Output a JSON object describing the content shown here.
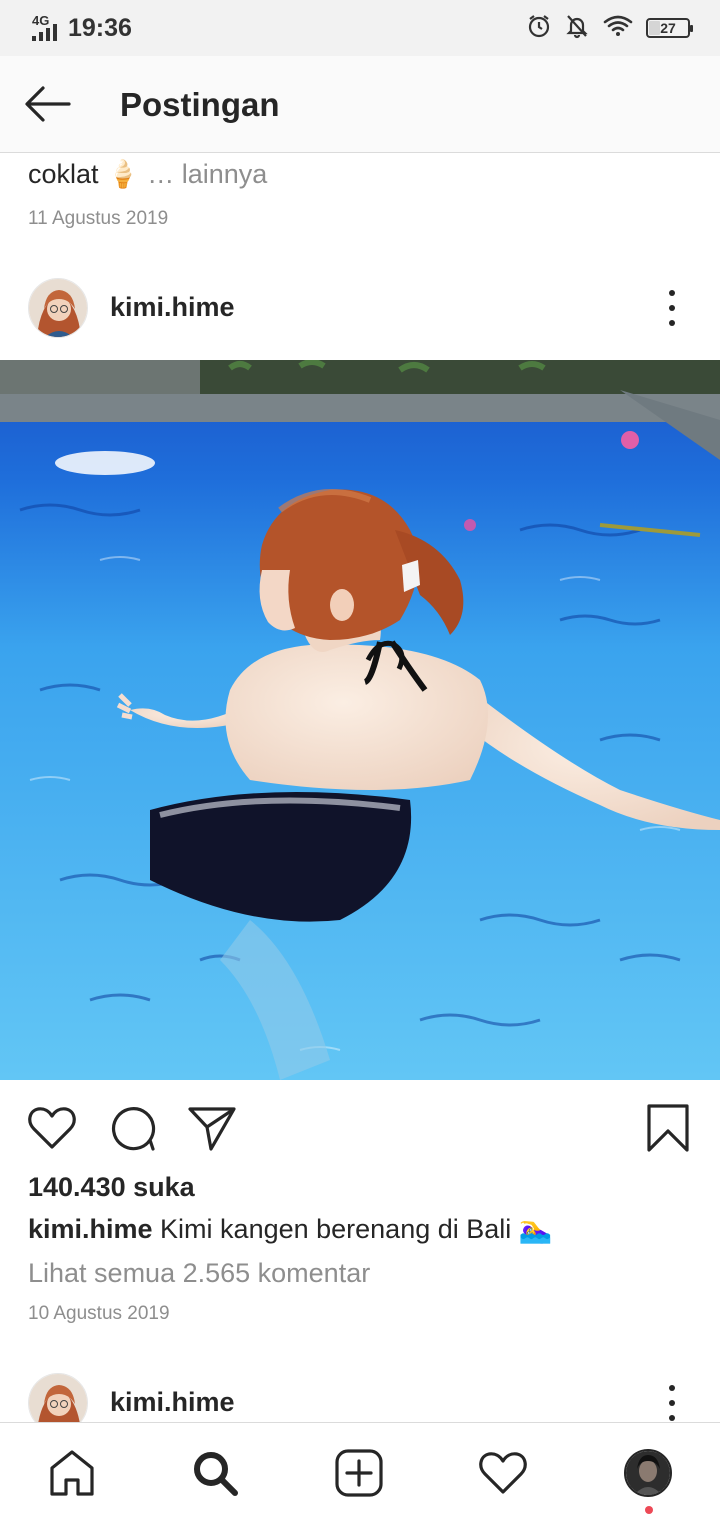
{
  "status_bar": {
    "network": "4G",
    "time": "19:36",
    "icons": [
      "alarm-icon",
      "notifications-off-icon",
      "wifi-icon",
      "battery-icon"
    ],
    "battery_level": "27"
  },
  "header": {
    "back_icon": "arrow-left-icon",
    "title": "Postingan"
  },
  "previous_post": {
    "caption_text": "coklat",
    "caption_emoji": "🍦",
    "more_label": "… lainnya",
    "date": "11 Agustus 2019"
  },
  "post": {
    "username": "kimi.hime",
    "options_icon": "more-vertical-icon",
    "image": "photo-woman-in-pool",
    "actions": [
      "heart-icon",
      "comment-icon",
      "share-icon",
      "bookmark-icon"
    ],
    "likes": "140.430 suka",
    "caption_username": "kimi.hime",
    "caption_text": " Kimi kangen berenang di Bali",
    "caption_emoji": "🏊‍♀️",
    "view_comments": "Lihat semua 2.565 komentar",
    "date": "10 Agustus 2019"
  },
  "next_post": {
    "username": "kimi.hime",
    "options_icon": "more-vertical-icon"
  },
  "bottom_nav": {
    "items": [
      "home-icon",
      "search-icon",
      "new-post-icon",
      "activity-heart-icon",
      "profile-avatar"
    ],
    "active": "search-icon",
    "profile_has_notification": true
  },
  "colors": {
    "text": "#262626",
    "secondary_text": "#8e8e8e",
    "divider": "#dbdbdb",
    "status_bar_bg": "#f2f2f2",
    "notification_dot": "#ed4956"
  }
}
